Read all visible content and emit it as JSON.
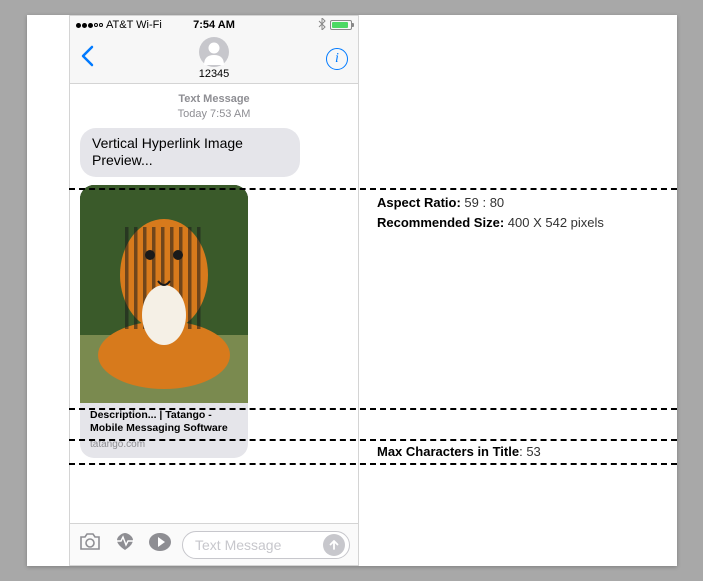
{
  "status": {
    "carrier": "AT&T Wi-Fi",
    "time": "7:54 AM",
    "bluetooth_glyph": "✱"
  },
  "nav": {
    "contact_number": "12345"
  },
  "conversation": {
    "meta_label": "Text Message",
    "meta_time": "Today 7:53 AM",
    "bubble_text": "Vertical Hyperlink Image Preview...",
    "card_title": "Description... | Tatango - Mobile Messaging Software",
    "card_domain": "tatango.com"
  },
  "compose": {
    "placeholder": "Text Message"
  },
  "annotations": {
    "ratio_label": "Aspect Ratio:",
    "ratio_value": " 59 : 80",
    "size_label": "Recommended Size:",
    "size_value": " 400 X 542 pixels",
    "maxchars_label": "Max Characters in Title",
    "maxchars_value": ": 53"
  }
}
